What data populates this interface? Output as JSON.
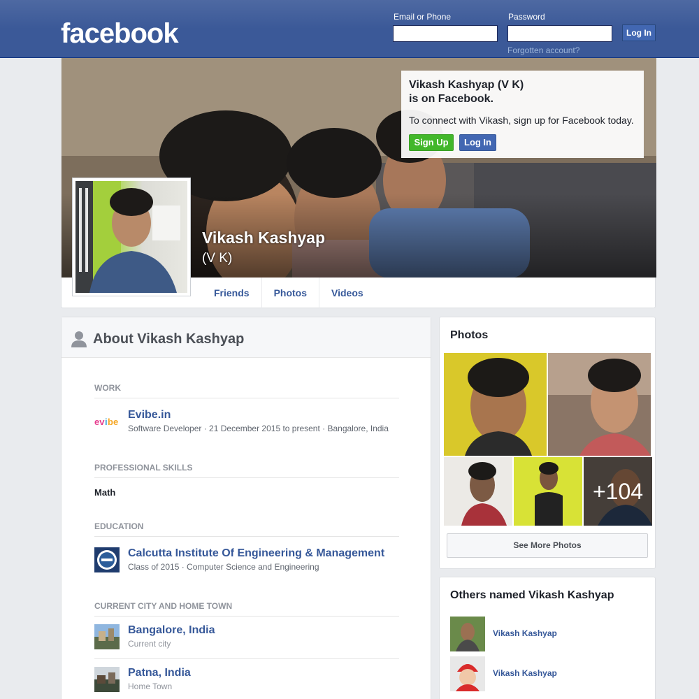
{
  "header": {
    "logo": "facebook",
    "email_label": "Email or Phone",
    "password_label": "Password",
    "login_button": "Log In",
    "forgot_link": "Forgotten account?"
  },
  "profile": {
    "name": "Vikash Kashyap",
    "alternate_name": "(V K)",
    "signup_prompt_title_line1": "Vikash Kashyap (V K)",
    "signup_prompt_title_line2": "is on Facebook.",
    "signup_prompt_desc": "To connect with Vikash, sign up for Facebook today.",
    "signup_button": "Sign Up",
    "login_button": "Log In",
    "tabs": [
      "Friends",
      "Photos",
      "Videos"
    ]
  },
  "about": {
    "title": "About Vikash Kashyap",
    "work_label": "WORK",
    "work": {
      "logo_text": "evibe",
      "company": "Evibe.in",
      "details": "Software Developer · 21 December 2015 to present · Bangalore, India"
    },
    "skills_label": "PROFESSIONAL SKILLS",
    "skill": "Math",
    "education_label": "EDUCATION",
    "education": {
      "school": "Calcutta Institute Of Engineering & Management",
      "details": "Class of 2015 · Computer Science and Engineering"
    },
    "places_label": "CURRENT CITY AND HOME TOWN",
    "places": [
      {
        "city": "Bangalore, India",
        "type": "Current city"
      },
      {
        "city": "Patna, India",
        "type": "Home Town"
      }
    ]
  },
  "photos": {
    "title": "Photos",
    "more_count": "+104",
    "see_more": "See More Photos"
  },
  "others": {
    "title": "Others named Vikash Kashyap",
    "people": [
      "Vikash Kashyap",
      "Vikash Kashyap"
    ]
  },
  "colors": {
    "brand_blue": "#3b5998",
    "link_blue": "#365899",
    "signup_green": "#42b72a"
  }
}
